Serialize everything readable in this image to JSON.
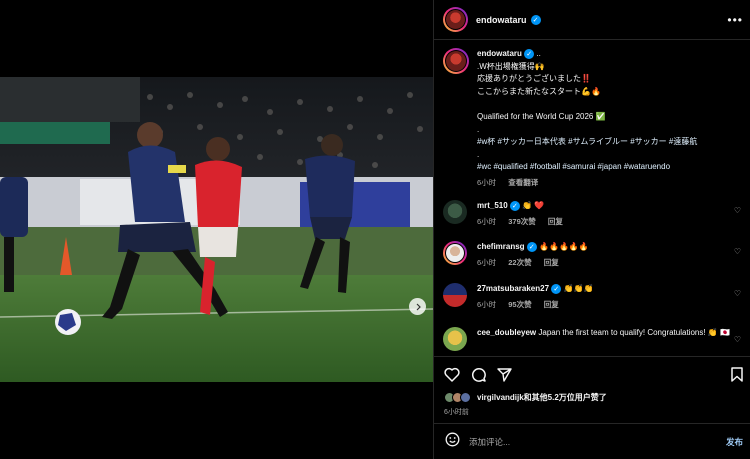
{
  "media": {
    "image_alt": "",
    "pagination_count": 2,
    "active_index": 0
  },
  "post": {
    "author": "endowataru",
    "author_verified": true,
    "more_label": "…",
    "caption": {
      "author": "endowataru",
      "suffix": " ..",
      "lines": [
        ".W杯出場権獲得🙌",
        "応援ありがとうございました‼️",
        "ここからまた新たなスタート💪🔥",
        "",
        "Qualified for the World Cup 2026 ✅",
        ".",
        "#w杯 #サッカー日本代表 #サムライブルー #サッカー #遠藤航",
        ".",
        "#wc #qualified #football #samurai #japan #wataruendo"
      ],
      "time": "6小时",
      "translate_label": "查看翻译"
    },
    "comments": [
      {
        "username": "mrt_510",
        "verified": true,
        "text": "👏 ❤️",
        "time": "6小时",
        "likes": "379次赞",
        "reply_label": "回复"
      },
      {
        "username": "chefimransg",
        "verified": true,
        "text": "🔥🔥🔥🔥🔥",
        "time": "6小时",
        "likes": "22次赞",
        "reply_label": "回复"
      },
      {
        "username": "27matsubaraken27",
        "verified": true,
        "text": "👏👏👏",
        "time": "6小时",
        "likes": "95次赞",
        "reply_label": "回复"
      },
      {
        "username": "cee_doubleyew",
        "verified": false,
        "text": "Japan the first team to qualify! Congratulations! 👏 🇯🇵",
        "time": "",
        "likes": "",
        "reply_label": ""
      }
    ],
    "likes_text": "virgilvandijk和其他5.2万位用户赞了",
    "time_ago": "6小时前",
    "comment_placeholder": "添加评论...",
    "post_button": "发布"
  },
  "colors": {
    "accent_blue": "#0095f6",
    "post_button": "#9ec9f3",
    "secondary_text": "#a8a8a8",
    "divider": "#262626",
    "heart_red": "#ed4956"
  },
  "icons": [
    "heart-icon",
    "comment-icon",
    "share-icon",
    "bookmark-icon",
    "emoji-icon",
    "more-icon",
    "chevron-right-icon",
    "verified-icon"
  ]
}
